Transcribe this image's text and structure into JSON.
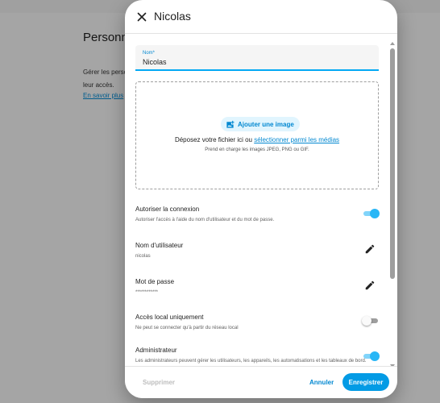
{
  "background": {
    "title": "Personne",
    "description": "Gérer les perso leur accès.",
    "learn_more": "En savoir plus"
  },
  "dialog": {
    "title": "Nicolas",
    "name_field": {
      "label": "Nom*",
      "value": "Nicolas"
    },
    "dropzone": {
      "add_image_label": "Ajouter une image",
      "drop_text": "Déposez votre fichier ici ou ",
      "drop_link": "sélectionner parmi les médias",
      "hint": "Prend en charge les images JPEG, PNG ou GIF."
    },
    "rows": {
      "allow_login": {
        "title": "Autoriser la connexion",
        "subtitle": "Autoriser l'accès à l'aide du nom d'utilisateur et du mot de passe.",
        "enabled": true
      },
      "username": {
        "title": "Nom d'utilisateur",
        "value": "nicolas"
      },
      "password": {
        "title": "Mot de passe",
        "value": "************"
      },
      "local_only": {
        "title": "Accès local uniquement",
        "subtitle": "Ne peut se connecter qu'à partir du réseau local",
        "enabled": false
      },
      "admin": {
        "title": "Administrateur",
        "subtitle": "Les administrateurs peuvent gérer les utilisateurs, les appareils, les automatisations et les tableaux de bord.",
        "enabled": true
      }
    },
    "footer": {
      "delete_label": "Supprimer",
      "cancel_label": "Annuler",
      "save_label": "Enregistrer"
    }
  },
  "colors": {
    "accent": "#039be5",
    "link": "#0288d1",
    "toggle_on": "#29b6f6"
  },
  "icons": {
    "close": "close-icon",
    "add_image": "add-image-icon",
    "edit": "pencil-icon"
  }
}
